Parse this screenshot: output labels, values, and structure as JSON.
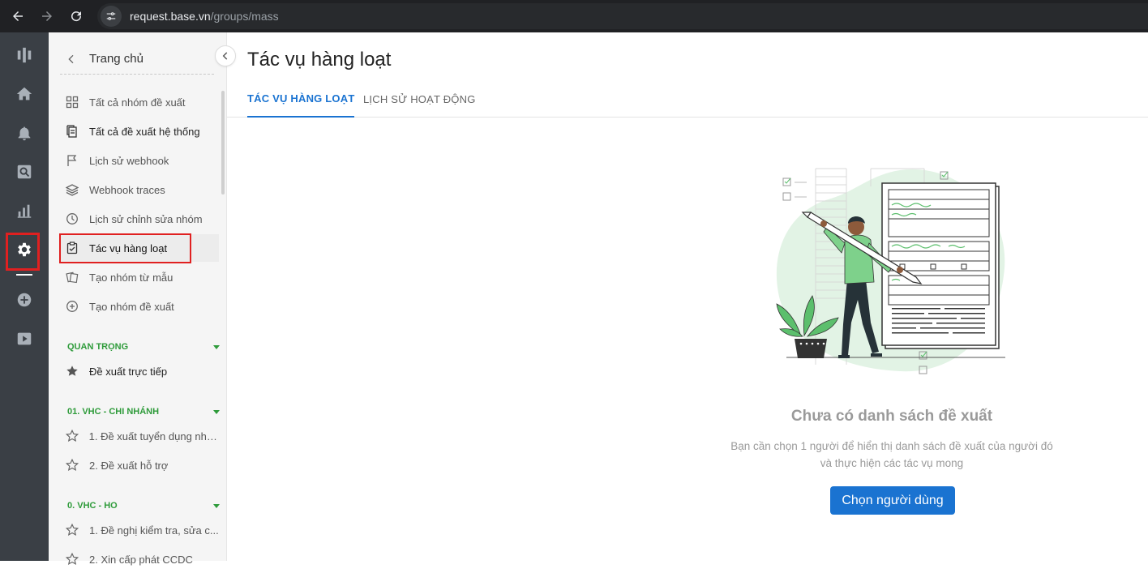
{
  "browser": {
    "url_host": "request.base.vn",
    "url_path": "/groups/mass"
  },
  "rail": {
    "items": [
      {
        "name": "brand-logo-icon"
      },
      {
        "name": "home-icon"
      },
      {
        "name": "bell-icon"
      },
      {
        "name": "search-doc-icon"
      },
      {
        "name": "bar-chart-icon"
      },
      {
        "name": "gear-icon"
      },
      {
        "name": "plus-circle-icon"
      },
      {
        "name": "play-icon"
      }
    ]
  },
  "sidebar": {
    "header": "Trang chủ",
    "items": [
      {
        "label": "Tất cả nhóm đề xuất",
        "icon": "grid-icon"
      },
      {
        "label": "Tất cả đề xuất hệ thống",
        "icon": "documents-icon"
      },
      {
        "label": "Lịch sử webhook",
        "icon": "flag-icon"
      },
      {
        "label": "Webhook traces",
        "icon": "layers-icon"
      },
      {
        "label": "Lịch sử chỉnh sửa nhóm",
        "icon": "clock-icon"
      },
      {
        "label": "Tác vụ hàng loạt",
        "icon": "clipboard-check-icon"
      },
      {
        "label": "Tạo nhóm từ mẫu",
        "icon": "cards-icon"
      },
      {
        "label": "Tạo nhóm đề xuất",
        "icon": "plus-circle-icon"
      }
    ],
    "sections": [
      {
        "title": "QUAN TRỌNG",
        "items": [
          {
            "label": "Đề xuất trực tiếp",
            "icon": "star-filled-icon"
          }
        ]
      },
      {
        "title": "01. VHC - CHI NHÁNH",
        "items": [
          {
            "label": "1. Đề xuất tuyển dụng nhâ...",
            "icon": "star-outline-icon"
          },
          {
            "label": "2. Đề xuất hỗ trợ",
            "icon": "star-outline-icon"
          }
        ]
      },
      {
        "title": "0. VHC - HO",
        "items": [
          {
            "label": "1. Đề nghị kiểm tra, sửa c...",
            "icon": "star-outline-icon"
          },
          {
            "label": "2. Xin cấp phát CCDC",
            "icon": "star-outline-icon"
          }
        ]
      }
    ]
  },
  "main": {
    "title": "Tác vụ hàng loạt",
    "tabs": [
      {
        "label": "TÁC VỤ HÀNG LOẠT",
        "active": true
      },
      {
        "label": "LỊCH SỬ HOẠT ĐỘNG",
        "active": false
      }
    ],
    "empty": {
      "title": "Chưa có danh sách đề xuất",
      "desc_line1": "Bạn cần chọn 1 người để hiển thị danh sách đề xuất của người đó",
      "desc_line2": "và thực hiện các tác vụ mong",
      "button": "Chọn người dùng"
    }
  },
  "colors": {
    "accent": "#1a73d1",
    "section_green": "#2e9b3a",
    "highlight_red": "#e02020",
    "rail_bg": "#3a3f45",
    "illustration_green": "#5cbf6d"
  }
}
